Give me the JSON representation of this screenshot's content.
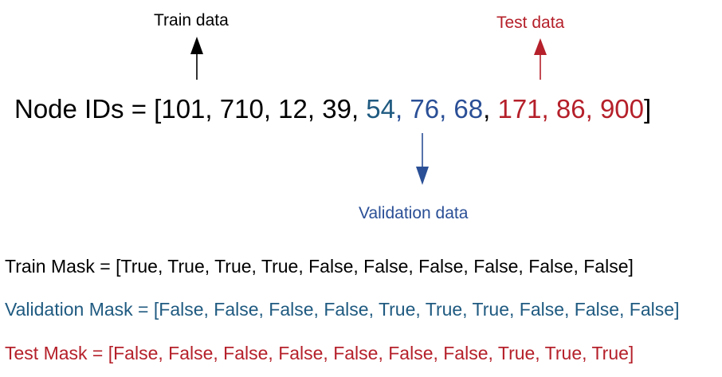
{
  "colors": {
    "train": "#000000",
    "validation": "#2a4f96",
    "validation_first": "#1f5a80",
    "test": "#b5202a"
  },
  "labels": {
    "train": "Train data",
    "test": "Test data",
    "validation": "Validation data"
  },
  "node_ids": {
    "prefix": "Node IDs = [",
    "train_ids": [
      "101",
      "710",
      "12",
      "39"
    ],
    "validation_ids": [
      "54",
      "76",
      "68"
    ],
    "test_ids": [
      "171",
      "86",
      "900"
    ],
    "suffix": "]"
  },
  "masks": {
    "train": {
      "prefix": "Train Mask = [",
      "values": "True, True, True, True, False, False, False, False, False, False",
      "suffix": "]"
    },
    "validation": {
      "prefix": "Validation Mask = [",
      "values": "False, False, False, False, True, True, True, False, False, False",
      "suffix": "]"
    },
    "test": {
      "prefix": "Test Mask = [",
      "values": "False, False, False, False, False, False, False, True, True, True",
      "suffix": "]"
    }
  }
}
